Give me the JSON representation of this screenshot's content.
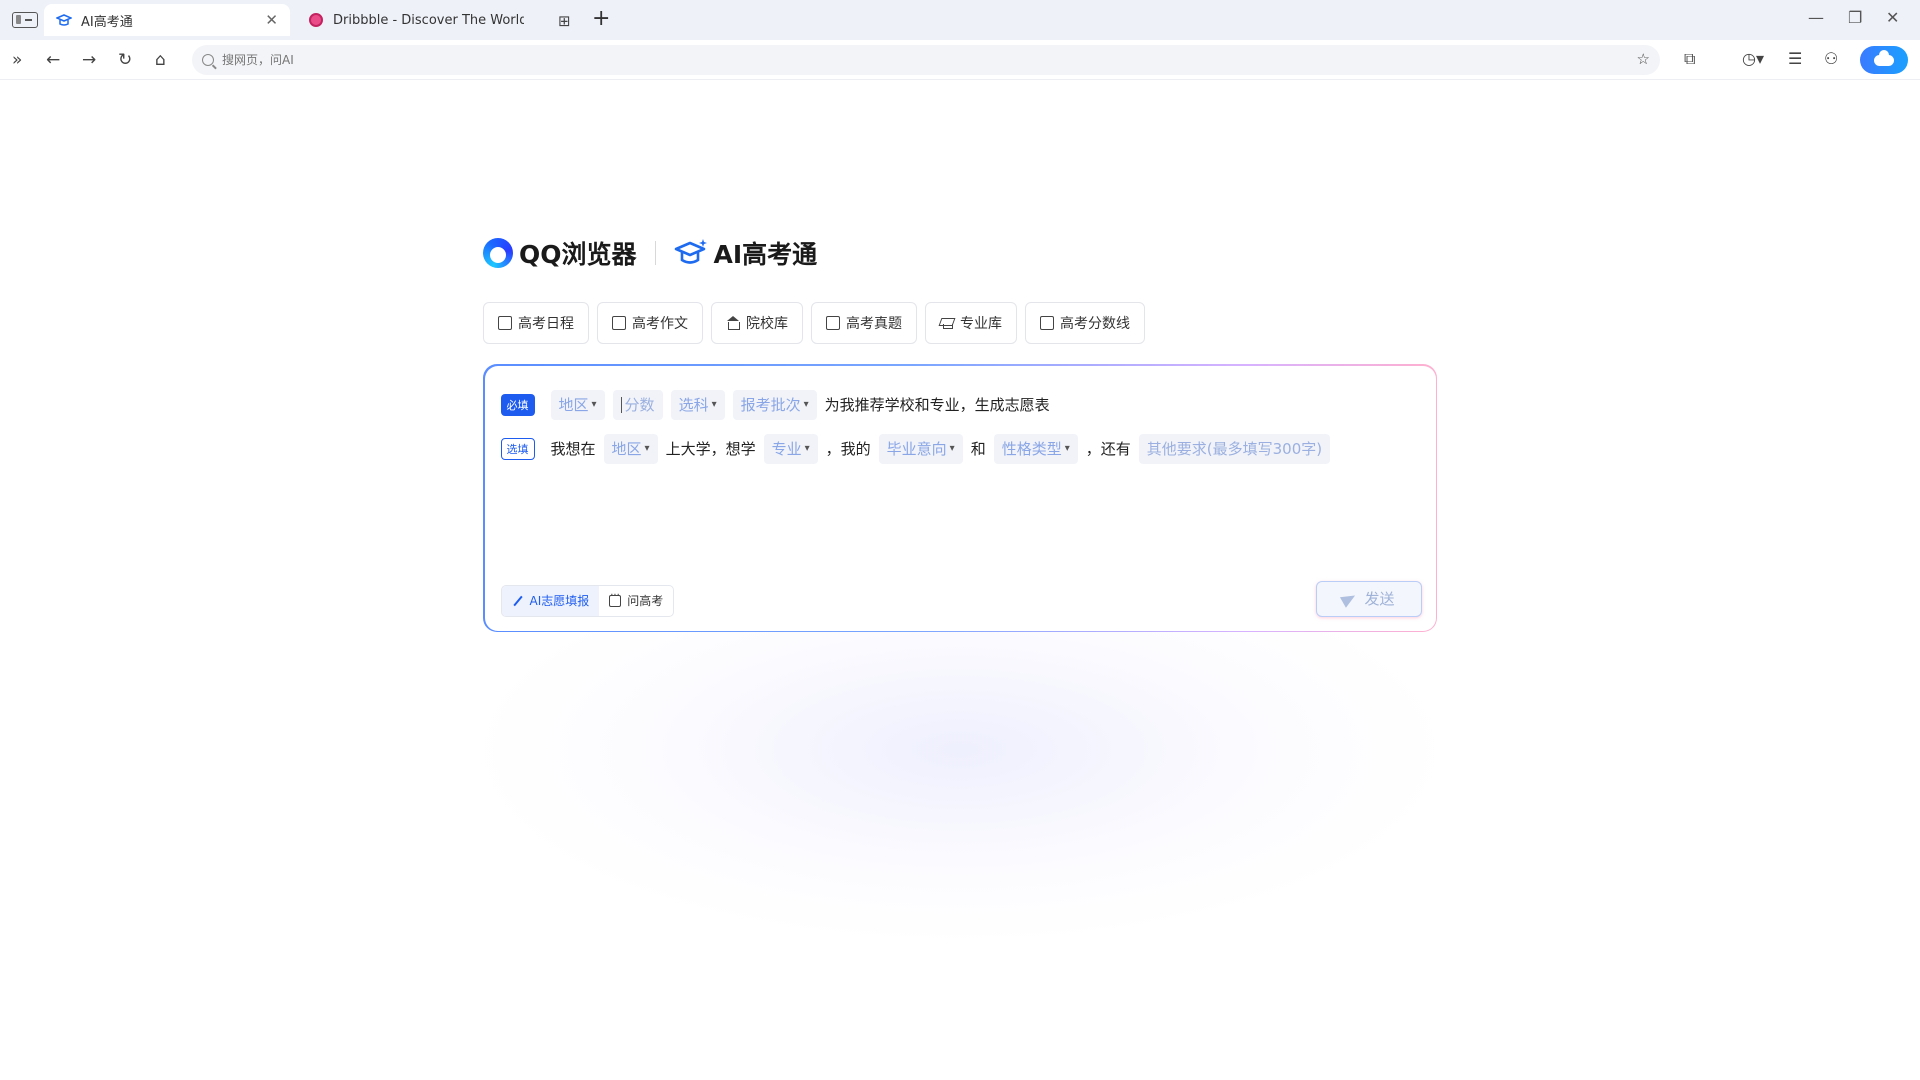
{
  "browser": {
    "tabs": [
      {
        "title": "AI高考通",
        "active": true
      },
      {
        "title": "Dribbble - Discover The World",
        "active": false
      }
    ],
    "address_placeholder": "搜网页，问AI"
  },
  "brand": {
    "browser_name": "QQ浏览器",
    "product_name": "AI高考通"
  },
  "quick_links": [
    {
      "label": "高考日程",
      "icon": "calendar-icon"
    },
    {
      "label": "高考作文",
      "icon": "edit-icon"
    },
    {
      "label": "院校库",
      "icon": "school-icon"
    },
    {
      "label": "高考真题",
      "icon": "document-icon"
    },
    {
      "label": "专业库",
      "icon": "graduation-cap-icon"
    },
    {
      "label": "高考分数线",
      "icon": "chart-icon"
    }
  ],
  "form": {
    "required_tag": "必填",
    "optional_tag": "选填",
    "row1": {
      "region": "地区",
      "score_placeholder": "分数",
      "subjects": "选科",
      "batch": "报考批次",
      "suffix": "为我推荐学校和专业，生成志愿表"
    },
    "row2": {
      "text1": "我想在",
      "region": "地区",
      "text2": "上大学，想学",
      "major": "专业",
      "text3": "，我的",
      "career": "毕业意向",
      "text4": "和",
      "personality": "性格类型",
      "text5": "，还有",
      "other_placeholder": "其他要求(最多填写300字)"
    },
    "modes": [
      {
        "label": "AI志愿填报",
        "active": true
      },
      {
        "label": "问高考",
        "active": false
      }
    ],
    "send_label": "发送"
  },
  "colors": {
    "accent": "#1e5cf0",
    "chip_text": "#8aa6e6"
  }
}
